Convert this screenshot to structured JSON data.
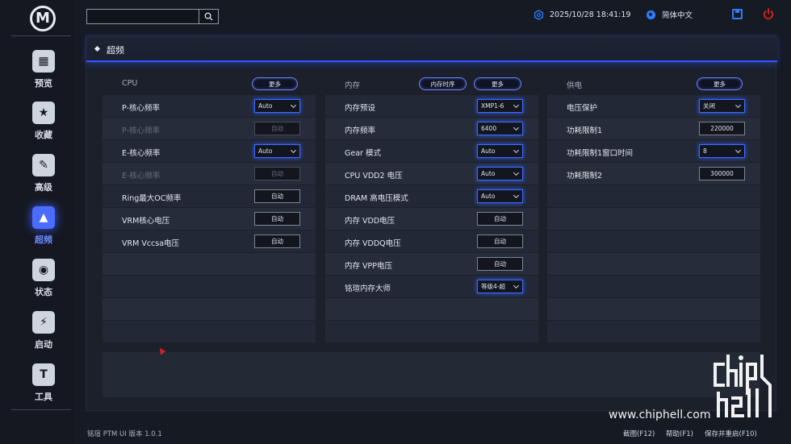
{
  "app": {
    "logo_letter": "M",
    "version": "铭瑄 PTM UI 版本 1.0.1"
  },
  "sidebar": {
    "items": [
      {
        "label": "预览",
        "icon": "grid-icon",
        "glyph": "▦"
      },
      {
        "label": "收藏",
        "icon": "star-icon",
        "glyph": "★"
      },
      {
        "label": "高级",
        "icon": "tools-icon",
        "glyph": "✎"
      },
      {
        "label": "超频",
        "icon": "rocket-icon",
        "glyph": "▲"
      },
      {
        "label": "状态",
        "icon": "status-icon",
        "glyph": "◉"
      },
      {
        "label": "启动",
        "icon": "ssd-icon",
        "glyph": "⚡"
      },
      {
        "label": "工具",
        "icon": "tool-box-icon",
        "glyph": "T"
      }
    ]
  },
  "topbar": {
    "search_value": "",
    "datetime": "2025/10/28 18:41:19",
    "language": "简体中文"
  },
  "page": {
    "title": "超频"
  },
  "columns": {
    "cpu": {
      "name": "CPU",
      "more": "更多",
      "rows": [
        {
          "label": "P-核心频率",
          "value": "Auto",
          "type": "select"
        },
        {
          "label": "P-核心频率",
          "value": "自动",
          "type": "disabled"
        },
        {
          "label": "E-核心频率",
          "value": "Auto",
          "type": "select"
        },
        {
          "label": "E-核心频率",
          "value": "自动",
          "type": "disabled"
        },
        {
          "label": "Ring最大OC频率",
          "value": "自动",
          "type": "button"
        },
        {
          "label": "VRM核心电压",
          "value": "自动",
          "type": "button"
        },
        {
          "label": "VRM Vccsa电压",
          "value": "自动",
          "type": "button"
        }
      ]
    },
    "memory": {
      "name": "内存",
      "timing": "内存时序",
      "more": "更多",
      "rows": [
        {
          "label": "内存预设",
          "value": "XMP1-6",
          "type": "select"
        },
        {
          "label": "内存频率",
          "value": "6400",
          "type": "select"
        },
        {
          "label": "Gear 模式",
          "value": "Auto",
          "type": "select"
        },
        {
          "label": "CPU VDD2 电压",
          "value": "Auto",
          "type": "select"
        },
        {
          "label": "DRAM 高电压模式",
          "value": "Auto",
          "type": "select"
        },
        {
          "label": "内存 VDD电压",
          "value": "自动",
          "type": "button"
        },
        {
          "label": "内存 VDDQ电压",
          "value": "自动",
          "type": "button"
        },
        {
          "label": "内存 VPP电压",
          "value": "自动",
          "type": "button"
        },
        {
          "label": "铭瑄内存大师",
          "value": "等级4-超",
          "type": "select"
        }
      ]
    },
    "power": {
      "name": "供电",
      "more": "更多",
      "rows": [
        {
          "label": "电压保护",
          "value": "关闭",
          "type": "select"
        },
        {
          "label": "功耗限制1",
          "value": "220000",
          "type": "number"
        },
        {
          "label": "功耗限制1窗口时间",
          "value": "8",
          "type": "select"
        },
        {
          "label": "功耗限制2",
          "value": "300000",
          "type": "number"
        }
      ]
    }
  },
  "footer": {
    "screenshot": "截图(F12)",
    "help": "帮助(F1)",
    "save_restart": "保存并重启(F10)"
  },
  "watermark": {
    "text": "www.chiphell.com"
  },
  "colors": {
    "accent": "#3357ff",
    "power": "#e02020",
    "save": "#2f7bff"
  }
}
